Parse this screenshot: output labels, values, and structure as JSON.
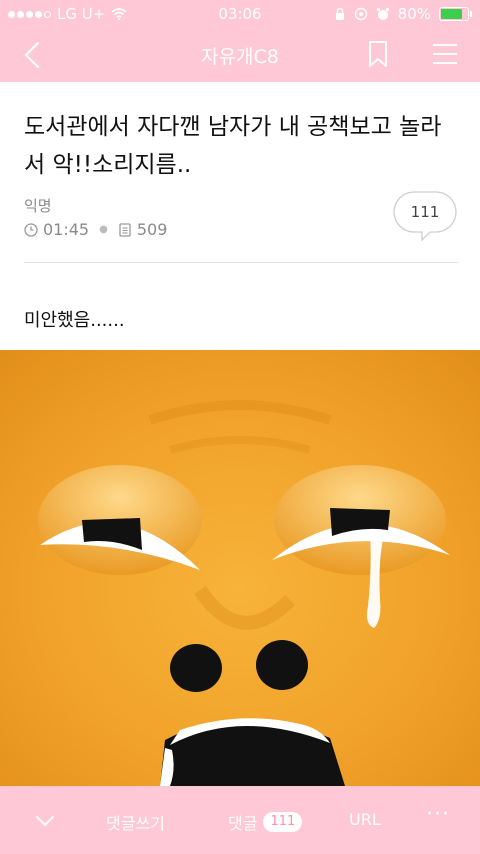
{
  "status_bar": {
    "carrier": "LG U+",
    "time": "03:06",
    "battery": "80%",
    "battery_level": 0.8,
    "icons": [
      "signal-dots-icon",
      "wifi-icon",
      "lock-rotation-icon",
      "location-icon",
      "alarm-icon",
      "battery-icon"
    ]
  },
  "nav": {
    "title": "자유개C8",
    "icons": [
      "back-chevron-icon",
      "bookmark-icon",
      "menu-icon"
    ]
  },
  "post": {
    "title": "도서관에서 자다깬 남자가 내 공책보고 놀라서 악!!소리지름..",
    "author": "익명",
    "time": "01:45",
    "views": "509",
    "comment_count": "111",
    "body": "미안했음......"
  },
  "toolbar": {
    "write_comment": "댓글쓰기",
    "comments_label": "댓글",
    "comments_count": "111",
    "url": "URL",
    "more": "···"
  },
  "colors": {
    "accent_pink": "#ffc8d6",
    "badge_text": "#ff8fae",
    "image_orange": "#f2a52a"
  }
}
